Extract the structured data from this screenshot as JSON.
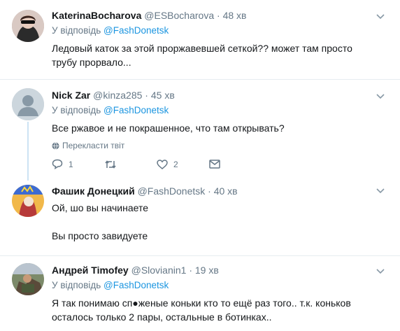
{
  "tweets": [
    {
      "name": "KaterinaBocharova",
      "handle": "@ESBocharova",
      "dot": "·",
      "time": "48 хв",
      "reply_prefix": "У відповідь",
      "reply_to": "@FashDonetsk",
      "text": "Ледовый каток за этой проржавевшей сеткой?? может там просто трубу прорвало..."
    },
    {
      "name": "Nick Zar",
      "handle": "@kinza285",
      "dot": "·",
      "time": "45 хв",
      "reply_prefix": "У відповідь",
      "reply_to": "@FashDonetsk",
      "text": "Все ржавое и не покрашенное, что там открывать?",
      "translate": "Перекласти твіт",
      "actions": {
        "replies": "1",
        "retweets": "",
        "likes": "2"
      }
    },
    {
      "name": "Фашик Донецкий",
      "handle": "@FashDonetsk",
      "dot": "·",
      "time": "40 хв",
      "text_line1": "Ой, шо вы начинаете",
      "text_line2": "Вы просто завидуете"
    },
    {
      "name": "Андрей Timofey",
      "handle": "@Slovianin1",
      "dot": "·",
      "time": "19 хв",
      "reply_prefix": "У відповідь",
      "reply_to": "@FashDonetsk",
      "text": "Я так понимаю сп●женые коньки кто то ещё раз того.. т.к. коньков осталось только 2 пары, остальные в ботинках.."
    }
  ],
  "colors": {
    "link": "#1b95e0",
    "muted": "#657786",
    "text": "#14171a",
    "border": "#e6ecf0",
    "thread": "#cce3f4"
  }
}
